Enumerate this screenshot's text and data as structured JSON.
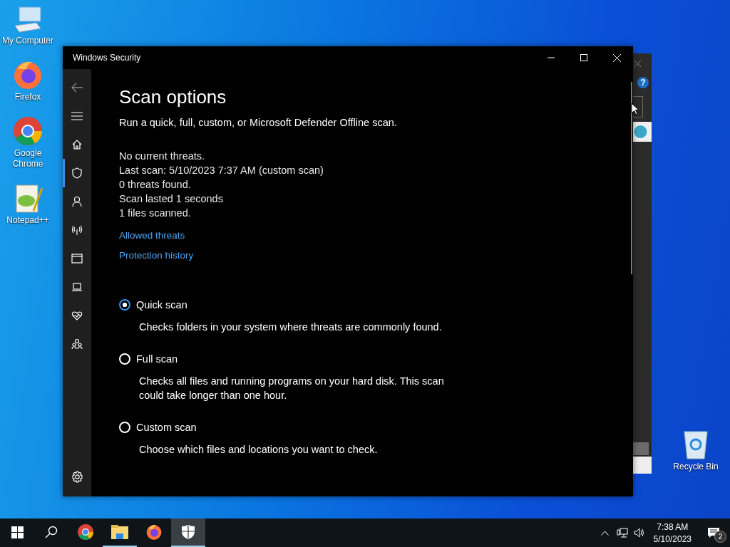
{
  "desktop_icons": [
    {
      "kind": "computer",
      "label": "My Computer"
    },
    {
      "kind": "firefox",
      "label": "Firefox"
    },
    {
      "kind": "chrome",
      "label": "Google Chrome"
    },
    {
      "kind": "notepad",
      "label": "Notepad++"
    }
  ],
  "recycle_bin": {
    "label": "Recycle Bin"
  },
  "background_window": {
    "help_glyph": "?"
  },
  "window": {
    "title": "Windows Security"
  },
  "nav_items": [
    {
      "kind": "home",
      "selected": false
    },
    {
      "kind": "shield",
      "selected": true
    },
    {
      "kind": "person",
      "selected": false
    },
    {
      "kind": "wireless",
      "selected": false
    },
    {
      "kind": "browser",
      "selected": false
    },
    {
      "kind": "laptop",
      "selected": false
    },
    {
      "kind": "heart",
      "selected": false
    },
    {
      "kind": "family",
      "selected": false
    }
  ],
  "page": {
    "title": "Scan options",
    "subtitle": "Run a quick, full, custom, or Microsoft Defender Offline scan.",
    "status_lines": [
      "No current threats.",
      "Last scan: 5/10/2023 7:37 AM (custom scan)",
      "0 threats found.",
      "Scan lasted 1 seconds",
      "1 files scanned."
    ],
    "links": [
      "Allowed threats",
      "Protection history"
    ],
    "options": [
      {
        "label": "Quick scan",
        "description": "Checks folders in your system where threats are commonly found.",
        "selected": true
      },
      {
        "label": "Full scan",
        "description": "Checks all files and running programs on your hard disk. This scan could take longer than one hour.",
        "selected": false
      },
      {
        "label": "Custom scan",
        "description": "Choose which files and locations you want to check.",
        "selected": false
      }
    ]
  },
  "taskbar": {
    "apps": [
      {
        "kind": "chrome",
        "running": false,
        "selected": false
      },
      {
        "kind": "explorer",
        "running": true,
        "selected": false
      },
      {
        "kind": "firefox",
        "running": false,
        "selected": false
      },
      {
        "kind": "security",
        "running": true,
        "selected": true
      }
    ],
    "time": "7:38 AM",
    "date": "5/10/2023",
    "notification_count": "2"
  }
}
